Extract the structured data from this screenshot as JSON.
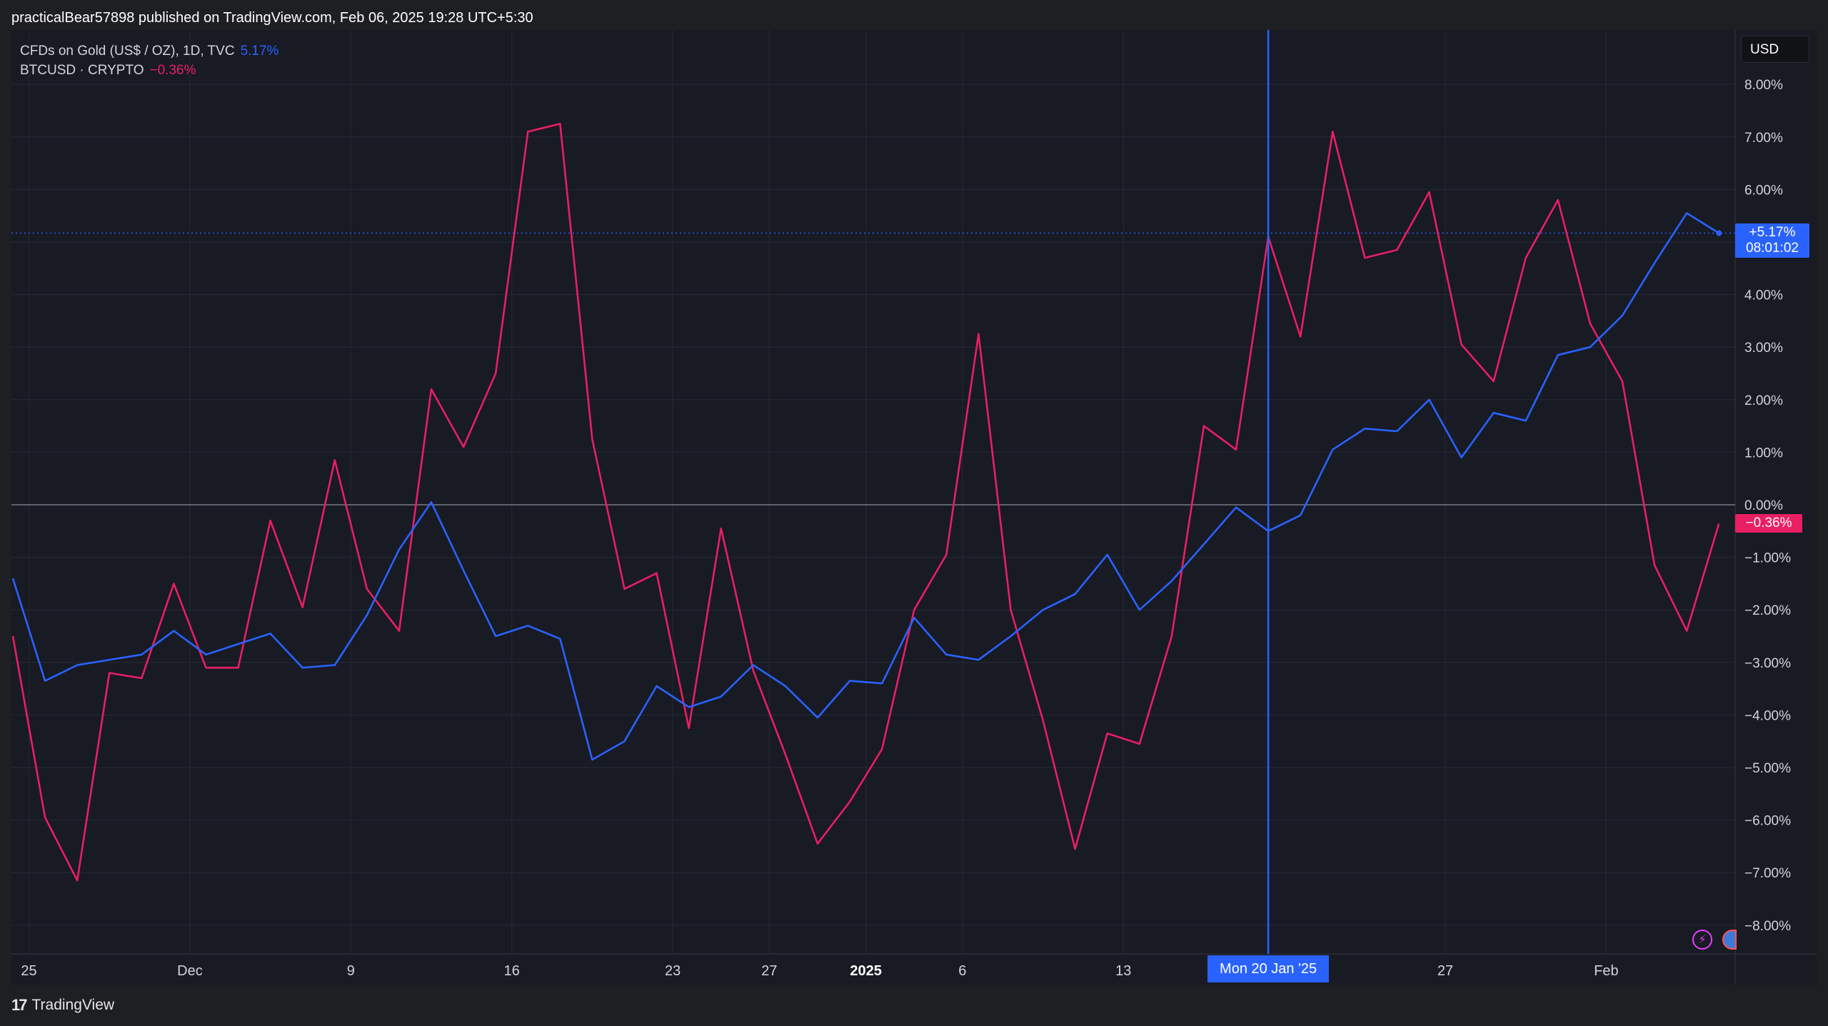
{
  "header": {
    "text": "practicalBear57898 published on TradingView.com, Feb 06, 2025 19:28 UTC+5:30"
  },
  "legend": [
    {
      "name": "CFDs on Gold (US$ / OZ), 1D, TVC",
      "value": "5.17%",
      "color": "#2962ff"
    },
    {
      "name": "BTCUSD · CRYPTO",
      "value": "−0.36%",
      "color": "#e91e63"
    }
  ],
  "currency": "USD",
  "footer": {
    "logo": "17",
    "brand": "TradingView"
  },
  "badges": {
    "gold": {
      "line1": "+5.17%",
      "line2": "08:01:02"
    },
    "btc": "−0.36%"
  },
  "crosshair": {
    "label": "Mon 20 Jan '25",
    "index": 39
  },
  "chart_data": {
    "type": "line",
    "title": "",
    "xlabel": "",
    "ylabel": "",
    "ylim": [
      -8.7,
      8.8
    ],
    "yticks": [
      {
        "value": 8,
        "label": "8.00%"
      },
      {
        "value": 7,
        "label": "7.00%"
      },
      {
        "value": 6,
        "label": "6.00%"
      },
      {
        "value": 5,
        "label": "5.00%"
      },
      {
        "value": 4,
        "label": "4.00%"
      },
      {
        "value": 3,
        "label": "3.00%"
      },
      {
        "value": 2,
        "label": "2.00%"
      },
      {
        "value": 1,
        "label": "1.00%"
      },
      {
        "value": 0,
        "label": "0.00%"
      },
      {
        "value": -1,
        "label": "−1.00%"
      },
      {
        "value": -2,
        "label": "−2.00%"
      },
      {
        "value": -3,
        "label": "−3.00%"
      },
      {
        "value": -4,
        "label": "−4.00%"
      },
      {
        "value": -5,
        "label": "−5.00%"
      },
      {
        "value": -6,
        "label": "−6.00%"
      },
      {
        "value": -7,
        "label": "−7.00%"
      },
      {
        "value": -8,
        "label": "−8.00%"
      }
    ],
    "xticks": [
      {
        "index": 0.5,
        "label": "25",
        "bold": false
      },
      {
        "index": 5.5,
        "label": "Dec",
        "bold": false
      },
      {
        "index": 10.5,
        "label": "9",
        "bold": false
      },
      {
        "index": 15.5,
        "label": "16",
        "bold": false
      },
      {
        "index": 20.5,
        "label": "23",
        "bold": false
      },
      {
        "index": 23.5,
        "label": "27",
        "bold": false
      },
      {
        "index": 26.5,
        "label": "2025",
        "bold": true
      },
      {
        "index": 29.5,
        "label": "6",
        "bold": false
      },
      {
        "index": 34.5,
        "label": "13",
        "bold": false
      },
      {
        "index": 44.5,
        "label": "27",
        "bold": false
      },
      {
        "index": 49.5,
        "label": "Feb",
        "bold": false
      }
    ],
    "grid": true,
    "legend_position": "top-left",
    "series": [
      {
        "name": "CFDs on Gold (US$ / OZ), 1D, TVC",
        "color": "#2962ff",
        "values": [
          -1.4,
          -3.35,
          -3.05,
          -2.95,
          -2.85,
          -2.4,
          -2.85,
          -2.65,
          -2.45,
          -3.1,
          -3.05,
          -2.1,
          -0.85,
          0.05,
          -1.25,
          -2.5,
          -2.3,
          -2.55,
          -4.85,
          -4.5,
          -3.45,
          -3.85,
          -3.65,
          -3.05,
          -3.45,
          -4.05,
          -3.35,
          -3.4,
          -2.15,
          -2.85,
          -2.95,
          -2.5,
          -2.0,
          -1.7,
          -0.95,
          -2.0,
          -1.45,
          -0.75,
          -0.05,
          -0.5,
          -0.2,
          1.05,
          1.45,
          1.4,
          2.0,
          0.9,
          1.75,
          1.6,
          2.85,
          3.0,
          3.6,
          4.6,
          5.55,
          5.17
        ]
      },
      {
        "name": "BTCUSD · CRYPTO",
        "color": "#e91e63",
        "values": [
          -2.5,
          -5.95,
          -7.15,
          -3.2,
          -3.3,
          -1.5,
          -3.1,
          -3.1,
          -0.3,
          -1.95,
          0.85,
          -1.6,
          -2.4,
          2.2,
          1.1,
          2.5,
          7.1,
          7.25,
          1.25,
          -1.6,
          -1.3,
          -4.25,
          -0.45,
          -3.15,
          -4.75,
          -6.45,
          -5.65,
          -4.65,
          -2.0,
          -0.95,
          3.25,
          -2.0,
          -4.1,
          -6.55,
          -4.35,
          -4.55,
          -2.5,
          1.5,
          1.05,
          5.1,
          3.2,
          7.1,
          4.7,
          4.85,
          5.95,
          3.05,
          2.35,
          4.7,
          5.8,
          3.45,
          2.35,
          -1.15,
          -2.4,
          -0.36
        ]
      }
    ]
  }
}
